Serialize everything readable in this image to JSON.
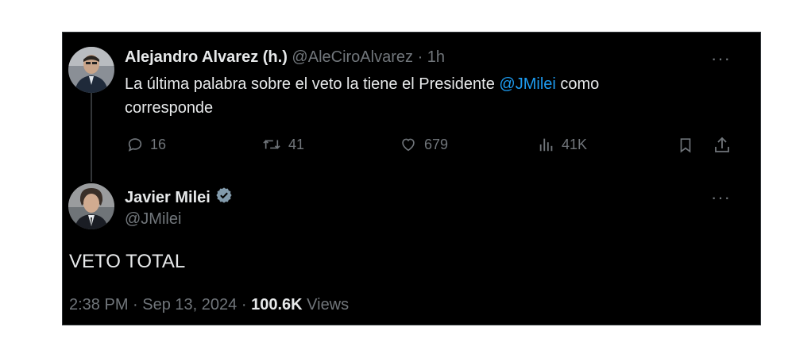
{
  "reply_tweet": {
    "author_name": "Alejandro Alvarez (h.)",
    "author_handle": "@AleCiroAlvarez",
    "separator": "·",
    "time_ago": "1h",
    "text_before": "La última palabra sobre el veto la tiene el Presidente ",
    "mention": "@JMilei",
    "text_after": " como corresponde",
    "more_label": "···",
    "replies": "16",
    "reposts": "41",
    "likes": "679",
    "views": "41K"
  },
  "main_tweet": {
    "author_name": "Javier Milei",
    "author_handle": "@JMilei",
    "more_label": "···",
    "text": "VETO TOTAL",
    "time": "2:38 PM",
    "separator": "·",
    "date": "Sep 13, 2024",
    "views_count": "100.6K",
    "views_label": "Views"
  },
  "colors": {
    "background": "#000000",
    "text": "#e7e9ea",
    "muted": "#71767b",
    "link": "#1d9bf0"
  },
  "icons": [
    "more-icon",
    "reply-icon",
    "repost-icon",
    "like-icon",
    "views-icon",
    "bookmark-icon",
    "share-icon",
    "verified-badge-icon"
  ]
}
